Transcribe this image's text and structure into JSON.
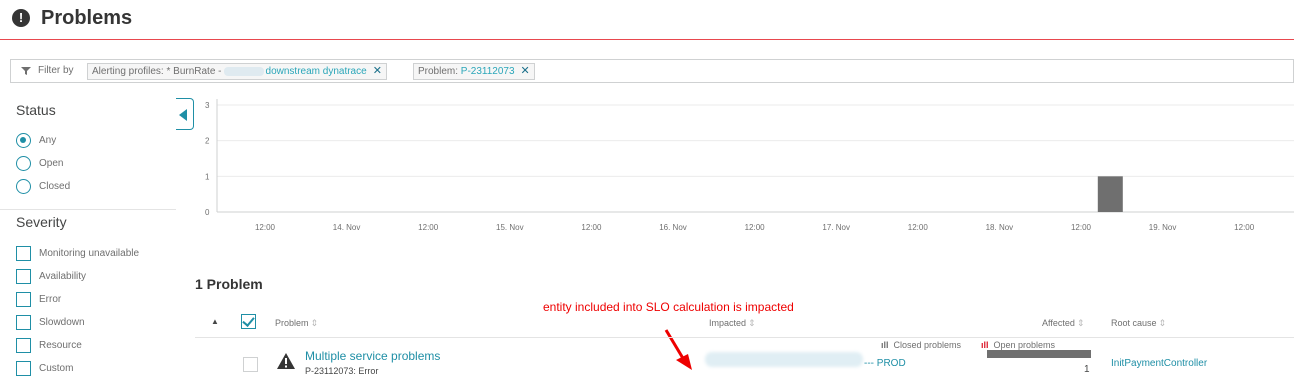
{
  "header": {
    "title": "Problems",
    "icon": "alert-circle-icon"
  },
  "filter": {
    "label": "Filter by",
    "chips": [
      {
        "prefix": "Alerting profiles: * BurnRate -",
        "value": "downstream dynatrace",
        "remove": "✕"
      },
      {
        "prefix": "Problem:",
        "value": "P-23112073",
        "remove": "✕"
      }
    ]
  },
  "sidebar": {
    "status": {
      "heading": "Status",
      "options": [
        {
          "label": "Any",
          "selected": true
        },
        {
          "label": "Open",
          "selected": false
        },
        {
          "label": "Closed",
          "selected": false
        }
      ]
    },
    "severity": {
      "heading": "Severity",
      "options": [
        {
          "label": "Monitoring unavailable",
          "checked": false
        },
        {
          "label": "Availability",
          "checked": false
        },
        {
          "label": "Error",
          "checked": false
        },
        {
          "label": "Slowdown",
          "checked": false
        },
        {
          "label": "Resource",
          "checked": false
        },
        {
          "label": "Custom",
          "checked": false
        }
      ]
    }
  },
  "chart_data": {
    "type": "bar",
    "y_ticks": [
      "3",
      "2",
      "1",
      "0"
    ],
    "ylim": [
      0,
      3
    ],
    "x_tick_labels": [
      "12:00",
      "14. Nov",
      "12:00",
      "15. Nov",
      "12:00",
      "16. Nov",
      "12:00",
      "17. Nov",
      "12:00",
      "18. Nov",
      "12:00",
      "19. Nov",
      "12:00"
    ],
    "series": [
      {
        "name": "Closed problems",
        "color": "#6f6f6f",
        "points": [
          {
            "x": "18. Nov 18:00",
            "value": 1
          }
        ]
      },
      {
        "name": "Open problems",
        "color": "#dc172a",
        "points": []
      }
    ],
    "legend": [
      "Closed problems",
      "Open problems"
    ],
    "legend_position": "bottom-right",
    "grid": true
  },
  "list": {
    "count_title": "1 Problem",
    "annotation": "entity included into SLO calculation is impacted",
    "columns": {
      "problem": "Problem",
      "impacted": "Impacted",
      "affected": "Affected",
      "root_cause": "Root cause"
    },
    "sort_symbol": "⇕",
    "rows": [
      {
        "title": "Multiple service problems",
        "subtitle": "P-23112073: Error",
        "impacted": "--- PROD",
        "affected": "1",
        "root_cause": "InitPaymentController"
      }
    ]
  },
  "colors": {
    "accent": "#1f8fa6",
    "header_rule": "#e8474e",
    "annotation": "#ee0000"
  }
}
